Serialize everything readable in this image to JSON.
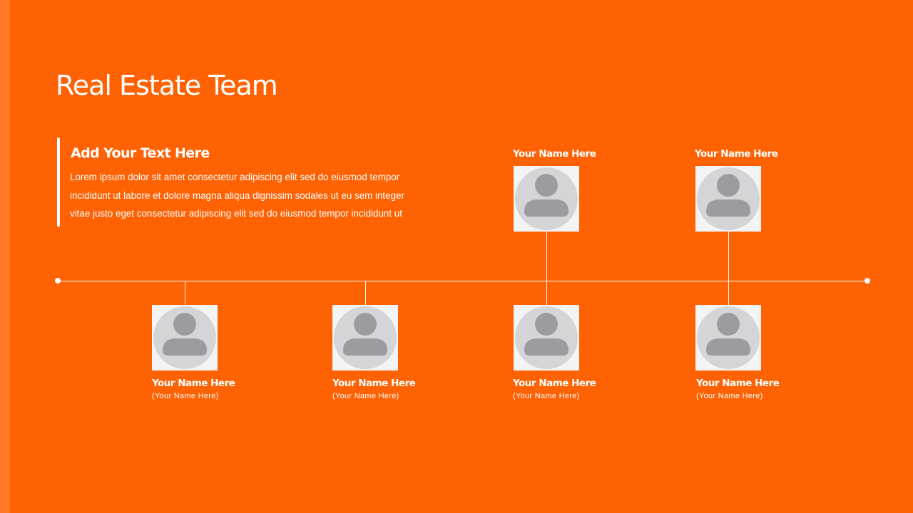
{
  "slide": {
    "title": "Real Estate Team",
    "text_block": {
      "heading": "Add Your Text Here",
      "lines": [
        "Lorem ipsum dolor sit amet consectetur adipiscing elit sed do eiusmod tempor",
        "incididunt ut labore et dolore magna aliqua dignissim sodales ut eu sem integer",
        "vitae justo eget consectetur adipiscing elit sed do eiusmod tempor incididunt ut"
      ]
    },
    "top_members": [
      {
        "name": "Your Name Here",
        "icon": "person-icon"
      },
      {
        "name": "Your Name Here",
        "icon": "person-icon"
      }
    ],
    "bottom_members": [
      {
        "name": "Your Name Here",
        "role": "(Your Name Here)",
        "icon": "person-icon"
      },
      {
        "name": "Your Name Here",
        "role": "(Your Name Here)",
        "icon": "person-icon"
      },
      {
        "name": "Your Name Here",
        "role": "(Your Name Here)",
        "icon": "person-icon"
      },
      {
        "name": "Your Name Here",
        "role": "(Your Name Here)",
        "icon": "person-icon"
      }
    ]
  },
  "colors": {
    "background": "#ff6203",
    "text": "#ffffff",
    "avatar_tile": "#f4f4f4",
    "avatar_circle": "#d4d5d7",
    "avatar_figure": "#9b9ca0"
  }
}
